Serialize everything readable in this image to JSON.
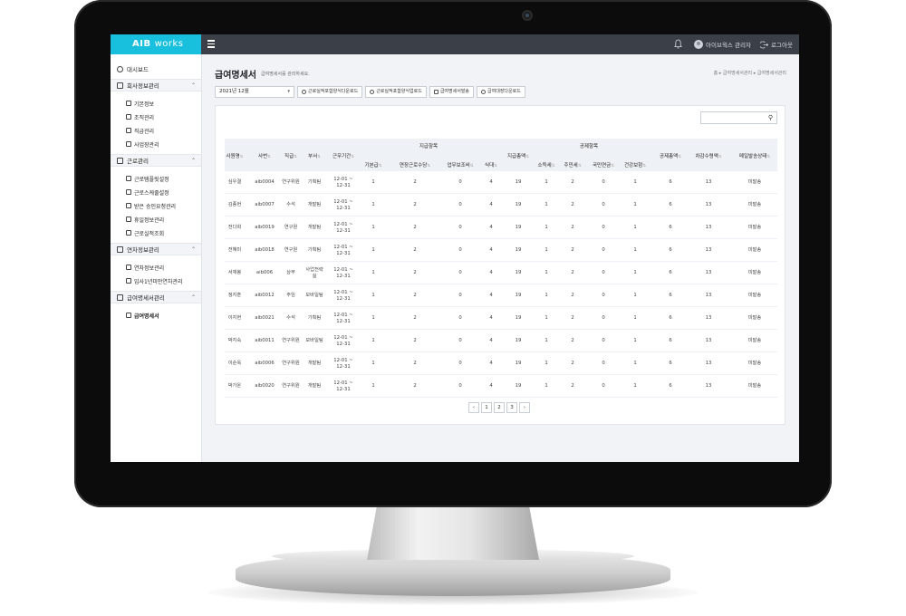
{
  "app": {
    "logo_brand": "AIB",
    "logo_suffix": "works"
  },
  "topbar": {
    "user_name": "아이브웍스 관리자",
    "logout_label": "로그아웃"
  },
  "sidebar": {
    "dashboard": "대시보드",
    "groups": [
      {
        "label": "회사정보관리",
        "items": [
          "기본정보",
          "조직관리",
          "직급관리",
          "사업장관리"
        ]
      },
      {
        "label": "근로관리",
        "items": [
          "근로템플릿설정",
          "근로스케줄설정",
          "받은 승인요청관리",
          "휴일정보관리",
          "근로실적조회"
        ]
      },
      {
        "label": "연차정보관리",
        "items": [
          "연차정보관리",
          "입사1년미만연차관리"
        ]
      },
      {
        "label": "급여명세서관리",
        "items": [
          "급여명세서"
        ]
      }
    ]
  },
  "page": {
    "title": "급여명세서",
    "subtitle": "급여명세서를 관리하세요.",
    "breadcrumb": "홈 ▸ 급여명세서관리 ▸ 급여명세서관리"
  },
  "toolbar": {
    "month_select": "2021년 12월",
    "buttons": [
      "근로실적포함양식다운로드",
      "근로실적포함양식업로드",
      "급여명세서발송",
      "급여대장다운로드"
    ]
  },
  "table": {
    "headers": {
      "employee_name": "사원명",
      "employee_no": "사번",
      "position": "직급",
      "dept": "부서",
      "work_period": "근무기간",
      "pay_group": "지급항목",
      "base_pay": "기본급",
      "overtime": "연장근로수당",
      "business": "업무보조비",
      "meal": "식대",
      "pay_total": "지급총액",
      "deduct_group": "공제항목",
      "income_tax": "소득세",
      "resident_tax": "주민세",
      "pension": "국민연금",
      "health": "건강보험",
      "deduct_total": "공제총액",
      "net_pay": "차감수령액",
      "mail_status": "메일발송상태"
    },
    "rows": [
      {
        "name": "심우결",
        "no": "aib0004",
        "pos": "연구위원",
        "dept": "기획팀",
        "period": "12-01 ~ 12-31",
        "base": "1",
        "ot": "2",
        "biz": "0",
        "meal": "4",
        "pay_total": "19",
        "itax": "1",
        "rtax": "2",
        "pension": "0",
        "health": "1",
        "ded_total": "6",
        "net": "13",
        "status": "미발송"
      },
      {
        "name": "김종현",
        "no": "aib0007",
        "pos": "수석",
        "dept": "개발팀",
        "period": "12-01 ~ 12-31",
        "base": "1",
        "ot": "2",
        "biz": "0",
        "meal": "4",
        "pay_total": "19",
        "itax": "1",
        "rtax": "2",
        "pension": "0",
        "health": "1",
        "ded_total": "6",
        "net": "13",
        "status": "미발송"
      },
      {
        "name": "전다희",
        "no": "aib0019",
        "pos": "연구원",
        "dept": "개발팀",
        "period": "12-01 ~ 12-31",
        "base": "1",
        "ot": "2",
        "biz": "0",
        "meal": "4",
        "pay_total": "19",
        "itax": "1",
        "rtax": "2",
        "pension": "0",
        "health": "1",
        "ded_total": "6",
        "net": "13",
        "status": "미발송"
      },
      {
        "name": "전혜미",
        "no": "aib0018",
        "pos": "연구원",
        "dept": "기획팀",
        "period": "12-01 ~ 12-31",
        "base": "1",
        "ot": "2",
        "biz": "0",
        "meal": "4",
        "pay_total": "19",
        "itax": "1",
        "rtax": "2",
        "pension": "0",
        "health": "1",
        "ded_total": "6",
        "net": "13",
        "status": "미발송"
      },
      {
        "name": "서재봉",
        "no": "aib006",
        "pos": "상무",
        "dept": "사업전략실",
        "period": "12-01 ~ 12-31",
        "base": "1",
        "ot": "2",
        "biz": "0",
        "meal": "4",
        "pay_total": "19",
        "itax": "1",
        "rtax": "2",
        "pension": "0",
        "health": "1",
        "ded_total": "6",
        "net": "13",
        "status": "미발송"
      },
      {
        "name": "정지훈",
        "no": "aib0012",
        "pos": "주임",
        "dept": "모바일팀",
        "period": "12-01 ~ 12-31",
        "base": "1",
        "ot": "2",
        "biz": "0",
        "meal": "4",
        "pay_total": "19",
        "itax": "1",
        "rtax": "2",
        "pension": "0",
        "health": "1",
        "ded_total": "6",
        "net": "13",
        "status": "미발송"
      },
      {
        "name": "이지현",
        "no": "aib0021",
        "pos": "수석",
        "dept": "기획팀",
        "period": "12-01 ~ 12-31",
        "base": "1",
        "ot": "2",
        "biz": "0",
        "meal": "4",
        "pay_total": "19",
        "itax": "1",
        "rtax": "2",
        "pension": "0",
        "health": "1",
        "ded_total": "6",
        "net": "13",
        "status": "미발송"
      },
      {
        "name": "박지숙",
        "no": "aib0011",
        "pos": "연구위원",
        "dept": "모바일팀",
        "period": "12-01 ~ 12-31",
        "base": "1",
        "ot": "2",
        "biz": "0",
        "meal": "4",
        "pay_total": "19",
        "itax": "1",
        "rtax": "2",
        "pension": "0",
        "health": "1",
        "ded_total": "6",
        "net": "13",
        "status": "미발송"
      },
      {
        "name": "이순옥",
        "no": "aib0006",
        "pos": "연구위원",
        "dept": "개발팀",
        "period": "12-01 ~ 12-31",
        "base": "1",
        "ot": "2",
        "biz": "0",
        "meal": "4",
        "pay_total": "19",
        "itax": "1",
        "rtax": "2",
        "pension": "0",
        "health": "1",
        "ded_total": "6",
        "net": "13",
        "status": "미발송"
      },
      {
        "name": "박가온",
        "no": "aib0020",
        "pos": "연구위원",
        "dept": "개발팀",
        "period": "12-01 ~ 12-31",
        "base": "1",
        "ot": "2",
        "biz": "0",
        "meal": "4",
        "pay_total": "19",
        "itax": "1",
        "rtax": "2",
        "pension": "0",
        "health": "1",
        "ded_total": "6",
        "net": "13",
        "status": "미발송"
      }
    ]
  },
  "pager": {
    "pages": [
      "1",
      "2",
      "3"
    ],
    "current": "1"
  },
  "colors": {
    "accent": "#19c0dd",
    "topbar": "#3a3f48"
  }
}
